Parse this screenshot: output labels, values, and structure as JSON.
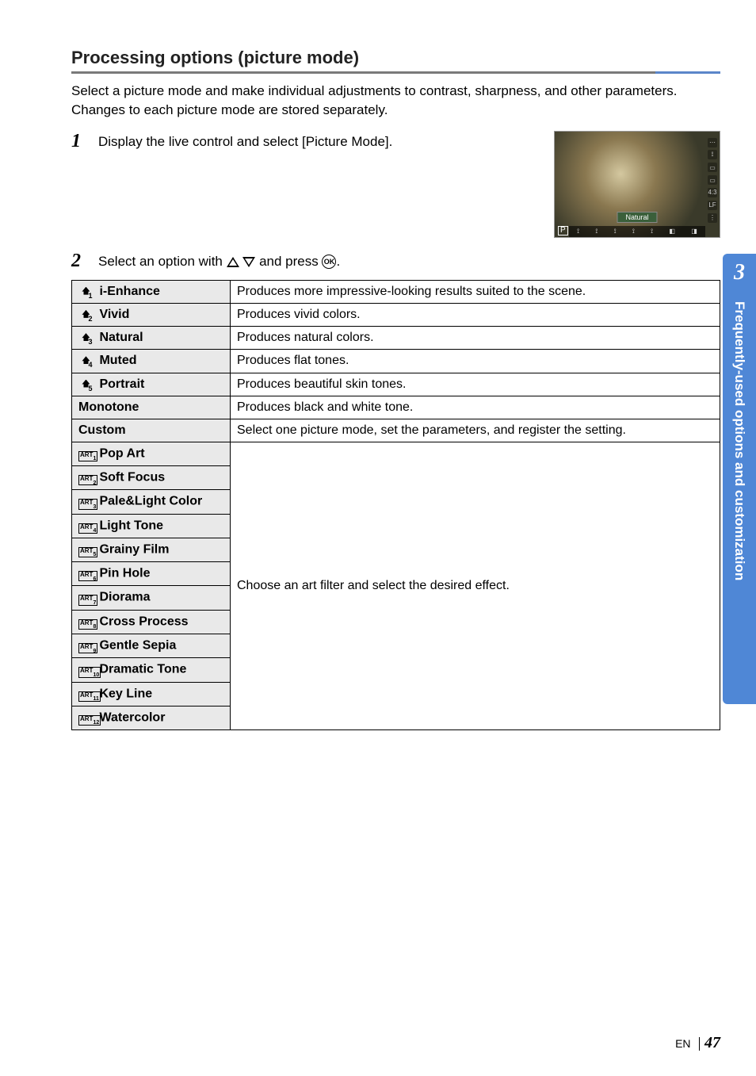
{
  "heading": "Processing options (picture mode)",
  "intro": "Select a picture mode and make individual adjustments to contrast, sharpness, and other parameters. Changes to each picture mode are stored separately.",
  "step1": {
    "num": "1",
    "text": "Display the live control and select [Picture Mode]."
  },
  "step2": {
    "num": "2",
    "text_before": "Select an option with ",
    "text_after": " and press ",
    "text_end": "."
  },
  "thumb": {
    "label": "Natural",
    "mode_badge": "P"
  },
  "ok_label": "OK",
  "rows_basic": [
    {
      "sub": "1",
      "name": "i-Enhance",
      "desc": "Produces more impressive-looking results suited to the scene."
    },
    {
      "sub": "2",
      "name": "Vivid",
      "desc": "Produces vivid colors."
    },
    {
      "sub": "3",
      "name": "Natural",
      "desc": "Produces natural colors."
    },
    {
      "sub": "4",
      "name": "Muted",
      "desc": "Produces flat tones."
    },
    {
      "sub": "5",
      "name": "Portrait",
      "desc": "Produces beautiful skin tones."
    }
  ],
  "row_monotone": {
    "name": "Monotone",
    "desc": "Produces black and white tone."
  },
  "row_custom": {
    "name": "Custom",
    "desc": "Select one picture mode, set the parameters, and register the setting."
  },
  "rows_art": [
    {
      "sub": "1",
      "name": "Pop Art"
    },
    {
      "sub": "2",
      "name": "Soft Focus"
    },
    {
      "sub": "3",
      "name": "Pale&Light Color"
    },
    {
      "sub": "4",
      "name": "Light Tone"
    },
    {
      "sub": "5",
      "name": "Grainy Film"
    },
    {
      "sub": "6",
      "name": "Pin Hole"
    },
    {
      "sub": "7",
      "name": "Diorama"
    },
    {
      "sub": "8",
      "name": "Cross Process"
    },
    {
      "sub": "9",
      "name": "Gentle Sepia"
    },
    {
      "sub": "10",
      "name": "Dramatic Tone"
    },
    {
      "sub": "11",
      "name": "Key Line"
    },
    {
      "sub": "12",
      "name": "Watercolor"
    }
  ],
  "art_desc": "Choose an art filter and select the desired effect.",
  "sidebar": {
    "chapter": "3",
    "title": "Frequently-used options and customization"
  },
  "footer": {
    "lang": "EN",
    "page": "47"
  }
}
